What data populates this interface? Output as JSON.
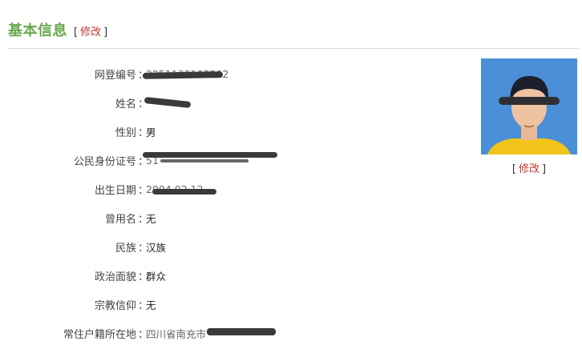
{
  "header": {
    "title": "基本信息",
    "edit_open": "[",
    "edit_label": "修改",
    "edit_close": "]"
  },
  "fields": [
    {
      "label": "网登编号",
      "value": "2251132103202",
      "redacted": true
    },
    {
      "label": "姓名",
      "value": "",
      "redacted": true
    },
    {
      "label": "性别",
      "value": "男",
      "redacted": false
    },
    {
      "label": "公民身份证号",
      "value": "51",
      "redacted": true
    },
    {
      "label": "出生日期",
      "value": "2004.02.12",
      "redacted": true
    },
    {
      "label": "曾用名",
      "value": "无",
      "redacted": false
    },
    {
      "label": "民族",
      "value": "汉族",
      "redacted": false
    },
    {
      "label": "政治面貌",
      "value": "群众",
      "redacted": false
    },
    {
      "label": "宗教信仰",
      "value": "无",
      "redacted": false
    },
    {
      "label": "常住户籍所在地",
      "value": "四川省南充市",
      "redacted": true
    }
  ],
  "colon": "：",
  "photo": {
    "edit_open": "[",
    "edit_label": "修改",
    "edit_close": "]",
    "background_color": "#4a8fd8"
  }
}
